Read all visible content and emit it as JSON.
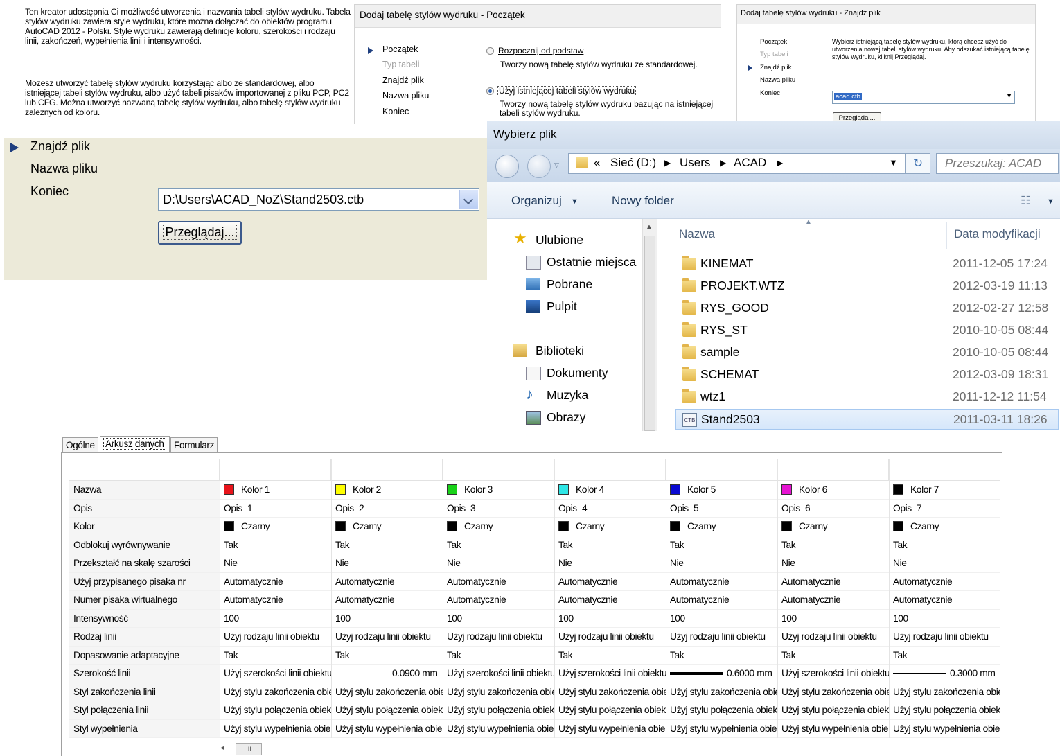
{
  "intro": {
    "paragraph1": "Ten kreator udostępnia Ci możliwość utworzenia i nazwania tabeli stylów wydruku. Tabela stylów wydruku zawiera style wydruku, które można dołączać do obiektów programu AutoCAD 2012 - Polski. Style wydruku zawierają definicje koloru, szerokości i rodzaju linii, zakończeń, wypełnienia linii i intensywności.",
    "paragraph2": "Możesz utworzyć tabelę stylów wydruku korzystając albo ze standardowej, albo istniejącej tabeli stylów wydruku, albo użyć tabeli pisaków importowanej z pliku PCP, PC2 lub CFG. Można utworzyć nazwaną tabelę stylów wydruku, albo tabelę stylów wydruku zależnych od koloru."
  },
  "wizard_start": {
    "title": "Dodaj tabelę stylów wydruku - Początek",
    "nav": [
      "Początek",
      "Typ tabeli",
      "Znajdź plik",
      "Nazwa pliku",
      "Koniec"
    ],
    "option1_label": "Rozpocznij od podstaw",
    "option1_desc": "Tworzy nową tabelę stylów wydruku ze standardowej.",
    "option2_label": "Użyj istniejącej tabeli stylów wydruku",
    "option2_desc": "Tworzy nową tabelę stylów wydruku bazując na istniejącej tabeli stylów wydruku."
  },
  "wizard_find": {
    "title": "Dodaj tabelę stylów wydruku - Znajdź plik",
    "nav": [
      "Początek",
      "Typ tabeli",
      "Znajdź plik",
      "Nazwa pliku",
      "Koniec"
    ],
    "description": "Wybierz istniejącą tabelę stylów wydruku, którą chcesz użyć do utworzenia nowej tabeli stylów wydruku. Aby odszukać istniejącą tabelę stylów wydruku, kliknij Przeglądaj.",
    "combo_value": "acad.ctb",
    "browse_label": "Przeglądaj..."
  },
  "wizard_zoom": {
    "nav": [
      "Znajdź plik",
      "Nazwa pliku",
      "Koniec"
    ],
    "combo_value": "D:\\Users\\ACAD_NoZ\\Stand2503.ctb",
    "browse_label": "Przeglądaj..."
  },
  "file_dialog": {
    "title": "Wybierz plik",
    "path_prefix": "«",
    "path": [
      "Sieć (D:)",
      "Users",
      "ACAD"
    ],
    "search_placeholder": "Przeszukaj: ACAD",
    "toolbar": {
      "organize": "Organizuj",
      "new_folder": "Nowy folder"
    },
    "sidebar": {
      "favorites": "Ulubione",
      "favorite_items": [
        "Ostatnie miejsca",
        "Pobrane",
        "Pulpit"
      ],
      "libraries": "Biblioteki",
      "library_items": [
        "Dokumenty",
        "Muzyka",
        "Obrazy"
      ]
    },
    "columns": {
      "name": "Nazwa",
      "date": "Data modyfikacji"
    },
    "files": [
      {
        "name": "KINEMAT",
        "date": "2011-12-05 17:24",
        "type": "folder"
      },
      {
        "name": "PROJEKT.WTZ",
        "date": "2012-03-19 11:13",
        "type": "folder"
      },
      {
        "name": "RYS_GOOD",
        "date": "2012-02-27 12:58",
        "type": "folder"
      },
      {
        "name": "RYS_ST",
        "date": "2010-10-05 08:44",
        "type": "folder"
      },
      {
        "name": "sample",
        "date": "2010-10-05 08:44",
        "type": "folder"
      },
      {
        "name": "SCHEMAT",
        "date": "2012-03-09 18:31",
        "type": "folder"
      },
      {
        "name": "wtz1",
        "date": "2011-12-12 11:54",
        "type": "folder"
      },
      {
        "name": "Stand2503",
        "date": "2011-03-11 18:26",
        "type": "ctb"
      }
    ],
    "ctb_icon_text": "CTB"
  },
  "property_grid": {
    "tabs": [
      "Ogólne",
      "Arkusz danych",
      "Formularz"
    ],
    "active_tab": 1,
    "row_labels": [
      "Nazwa",
      "Opis",
      "Kolor",
      "Odblokuj wyrównywanie",
      "Przekształć na skalę szarości",
      "Użyj przypisanego pisaka nr",
      "Numer pisaka wirtualnego",
      "Intensywność",
      "Rodzaj linii",
      "Dopasowanie adaptacyjne",
      "Szerokość linii",
      "Styl zakończenia linii",
      "Styl połączenia linii",
      "Styl wypełnienia"
    ],
    "columns": [
      {
        "name": "Kolor 1",
        "swatch": "#e8141b",
        "opis": "Opis_1",
        "lineweight": "Użyj szerokości linii obiektu",
        "lineweight_value": null
      },
      {
        "name": "Kolor 2",
        "swatch": "#ffff00",
        "opis": "Opis_2",
        "lineweight": "0.0900 mm",
        "lineweight_value": 0.09
      },
      {
        "name": "Kolor 3",
        "swatch": "#19d219",
        "opis": "Opis_3",
        "lineweight": "Użyj szerokości linii obiektu",
        "lineweight_value": null
      },
      {
        "name": "Kolor 4",
        "swatch": "#2ee6e6",
        "opis": "Opis_4",
        "lineweight": "Użyj szerokości linii obiektu",
        "lineweight_value": null
      },
      {
        "name": "Kolor 5",
        "swatch": "#0a0ad2",
        "opis": "Opis_5",
        "lineweight": "0.6000 mm",
        "lineweight_value": 0.6
      },
      {
        "name": "Kolor 6",
        "swatch": "#e614d2",
        "opis": "Opis_6",
        "lineweight": "Użyj szerokości linii obiektu",
        "lineweight_value": null
      },
      {
        "name": "Kolor 7",
        "swatch": "#000000",
        "opis": "Opis_7",
        "lineweight": "0.3000 mm",
        "lineweight_value": 0.3
      }
    ],
    "shared": {
      "kolor": "Czarny",
      "kolor_swatch": "#000000",
      "odblokuj": "Tak",
      "szarosc": "Nie",
      "pisak": "Automatycznie",
      "wirtualny": "Automatycznie",
      "intensywnosc": "100",
      "rodzaj": "Użyj rodzaju linii obiektu",
      "dopasowanie": "Tak",
      "zakonczenie": "Użyj stylu zakończenia obiektu",
      "polaczenie": "Użyj stylu połączenia obiektu",
      "wypelnienie": "Użyj stylu wypełnienia obiektu"
    },
    "scroll_thumb": "III"
  }
}
